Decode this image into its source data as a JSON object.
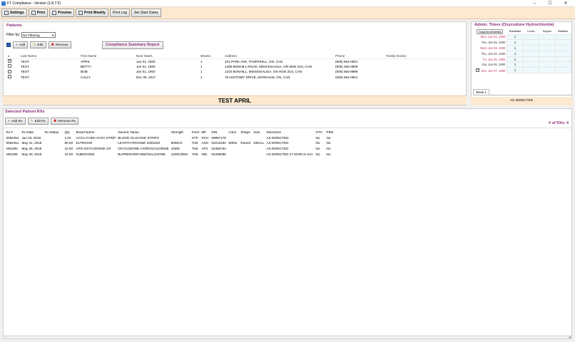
{
  "window": {
    "title": "FT Compliance - Version (1.8.7.5)"
  },
  "toolbar": {
    "settings": "Settings",
    "print": "Print",
    "preview": "Preview",
    "print_weekly": "Print Weekly",
    "print_log": "Print Log",
    "set_start_dates": "Set Start Dates"
  },
  "patients": {
    "title": "Patients",
    "filter_label": "Filter by:",
    "filter_value": "No Filtering",
    "add": "Add",
    "edit": "Edit",
    "remove": "Remove",
    "report_button": "Compliance Summary Report",
    "columns": [
      "x",
      "Last Name",
      "First Name",
      "Next Starts",
      "Weeks",
      "Address",
      "Phone",
      "Family Doctor"
    ],
    "rows": [
      {
        "checked": true,
        "last": "TEST",
        "first": "APRIL",
        "next": "Jan 01, 1900",
        "weeks": "1",
        "address": "101 PARK AVE, THORNHILL, ON, CAN",
        "phone": "(905) 564-0501",
        "doctor": ""
      },
      {
        "checked": false,
        "last": "TEST",
        "first": "BETTY",
        "next": "Jan 01, 1900",
        "weeks": "1",
        "address": "1495 BONHILL ROAD, MISSISSAUGA, ON M3N 2C5, CAN",
        "phone": "(905) 465-0909",
        "doctor": ""
      },
      {
        "checked": false,
        "last": "TEST",
        "first": "BOB",
        "next": "Jan 01, 1900",
        "weeks": "1",
        "address": "1234 BONHILL, MISSISSAUGA, ON HGN 2C5, CAN",
        "phone": "(905) 555-9999",
        "doctor": ""
      },
      {
        "checked": false,
        "last": "TEST",
        "first": "CALLY",
        "next": "Dec 05, 2017",
        "weeks": "1",
        "address": "78 ANATOMY DRIVE, MARKHAM, ON, CAN",
        "phone": "(905) 564-0501",
        "doctor": ""
      }
    ],
    "banner": "TEST APRIL"
  },
  "admin": {
    "title": "Admin. Times (Oxycodone Hydrochloride)",
    "copy_button": "Copy for all weeks",
    "headers": [
      "Breakfast",
      "Lunch",
      "Supper",
      "Bedtime"
    ],
    "days": [
      {
        "label": "Mon, Jan 01, 1900",
        "color": "#c0306a",
        "breakfast": "1"
      },
      {
        "label": "Tue, Jan 02, 1900",
        "color": "#333333",
        "breakfast": "1"
      },
      {
        "label": "Wed, Jan 03, 1900",
        "color": "#c0306a",
        "breakfast": "1"
      },
      {
        "label": "Thu, Jan 04, 1900",
        "color": "#333333",
        "breakfast": "1"
      },
      {
        "label": "Fri, Jan 05, 1900",
        "color": "#c0306a",
        "breakfast": "1"
      },
      {
        "label": "Sat, Jan 06, 1900",
        "color": "#333333",
        "breakfast": "1"
      },
      {
        "label": "Sun, Jan 07, 1900",
        "color": "#c0306a",
        "breakfast": "1"
      }
    ],
    "week_tab": "Week 1",
    "directions": "AS DIRECTED"
  },
  "rx": {
    "title": "Selected Patient RXs",
    "add": "Add Rx",
    "edit": "Edit Rx",
    "remove": "Remove Rx",
    "count": "# of RXs: 4",
    "columns": [
      "Rx #",
      "Rx Date",
      "Rx Status",
      "Qty",
      "Brand Name",
      "Generic Name",
      "Strength",
      "Form",
      "Mfr",
      "DIN",
      "Color",
      "Shape",
      "Size",
      "Directions",
      "OTC",
      "PRN"
    ],
    "rows": [
      [
        "0082452",
        "Jun 03, 2018",
        "",
        "1.00",
        "ACCU-CHEK AVIVA STRIP",
        "BLOOD GLUCOSE STRIPS",
        "",
        "STP",
        "RCH",
        "09857178",
        "",
        "",
        "",
        "AS DIRECTED",
        "No",
        "No"
      ],
      [
        "0082451",
        "May 31, 2018",
        "",
        "90.00",
        "ELTROXIN",
        "LEVOTHYROXINE SODIUM",
        "50MCG",
        "TAB",
        "ASN",
        "02213192",
        "White",
        "Round",
        "SMALL",
        "AS DIRECTED",
        "No",
        "No"
      ],
      [
        "N01080",
        "May 28, 2018",
        "",
        "10.00",
        "APO-OXYCODONE CR",
        "OXYCODONE HYDROCHLORIDE",
        "10MG",
        "TAB",
        "APX",
        "02366754",
        "",
        "",
        "",
        "AS DIRECTED",
        "No",
        "No"
      ],
      [
        "N01089",
        "May 30, 2018",
        "",
        "15.00",
        "SUBOXONE",
        "BUPRENORPHINE/NALOXONE",
        "12MG/3MG",
        "TAB",
        "IND",
        "02468085",
        "",
        "",
        "",
        "AS DIRECTED 27 MARCH JLH",
        "No",
        "No"
      ]
    ]
  }
}
